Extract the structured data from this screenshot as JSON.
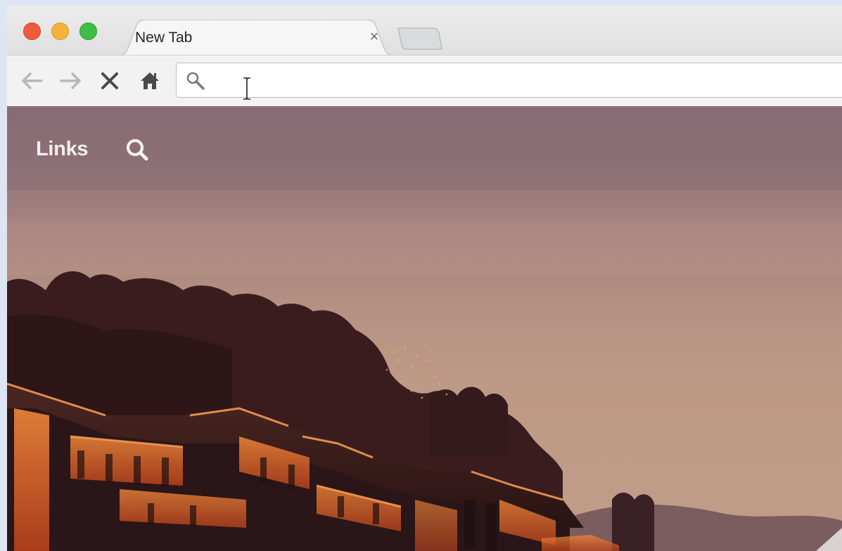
{
  "browser": {
    "tab": {
      "title": "New Tab",
      "close_glyph": "×"
    },
    "toolbar": {
      "back_icon": "back-arrow-icon",
      "forward_icon": "forward-arrow-icon",
      "stop_icon": "stop-icon",
      "home_icon": "home-icon"
    },
    "omnibox": {
      "value": "",
      "icon": "search-icon"
    }
  },
  "page": {
    "nav_links_label": "Links",
    "nav_search_icon": "search-icon",
    "background": "dusk-village-photo"
  },
  "colors": {
    "traffic_red": "#ee5a3c",
    "traffic_yellow": "#f3b33b",
    "traffic_green": "#3dbd45",
    "sky_top": "#8f7078",
    "sky_bottom": "#c09d89",
    "lights_orange": "#e0662a"
  }
}
